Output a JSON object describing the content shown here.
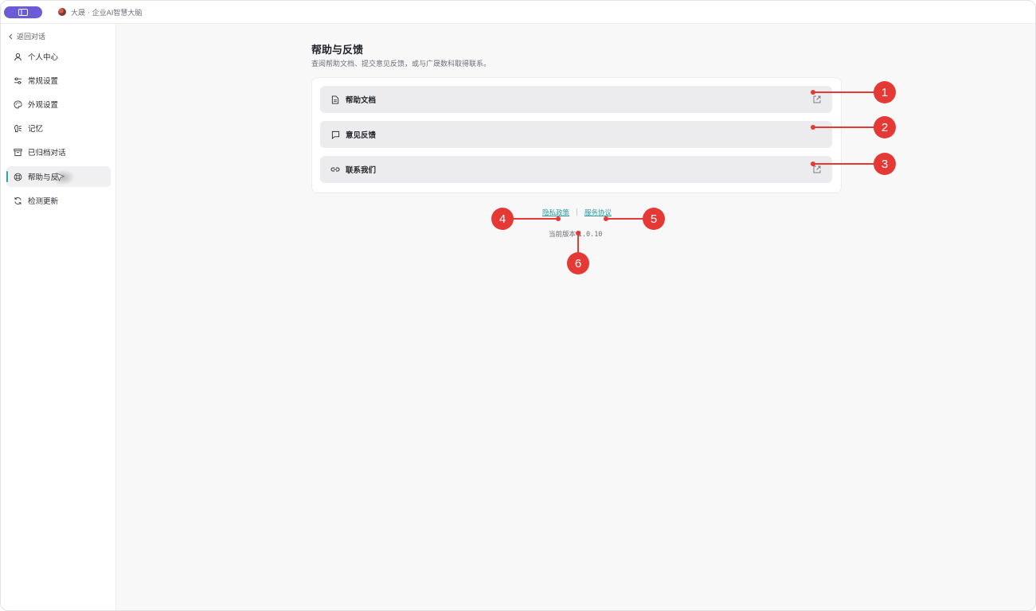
{
  "titlebar": {
    "app_name": "大晟 · 企业AI智慧大脑"
  },
  "sidebar": {
    "back_label": "返回对话",
    "items": [
      {
        "label": "个人中心",
        "icon": "user-icon"
      },
      {
        "label": "常规设置",
        "icon": "sliders-icon"
      },
      {
        "label": "外观设置",
        "icon": "palette-icon"
      },
      {
        "label": "记忆",
        "icon": "brain-icon"
      },
      {
        "label": "已归档对话",
        "icon": "archive-icon"
      },
      {
        "label": "帮助与反",
        "icon": "lifebuoy-icon",
        "active": true
      },
      {
        "label": "检测更新",
        "icon": "refresh-icon"
      }
    ]
  },
  "main": {
    "title": "帮助与反馈",
    "subtitle": "查阅帮助文档、提交意见反馈，或与广晟数科取得联系。",
    "rows": [
      {
        "label": "帮助文档",
        "icon": "document-icon",
        "external": true
      },
      {
        "label": "意见反馈",
        "icon": "message-icon",
        "external": false
      },
      {
        "label": "联系我们",
        "icon": "link-icon",
        "external": true
      }
    ],
    "privacy_link": "隐私政策",
    "separator": "|",
    "terms_link": "服务协议",
    "version_label": "当前版本",
    "version_number": "1.0.10"
  },
  "annotations": [
    "1",
    "2",
    "3",
    "4",
    "5",
    "6"
  ],
  "colors": {
    "accent": "#2aa3a8",
    "brand_pill": "#6b5bd6",
    "callout": "#e53935"
  }
}
